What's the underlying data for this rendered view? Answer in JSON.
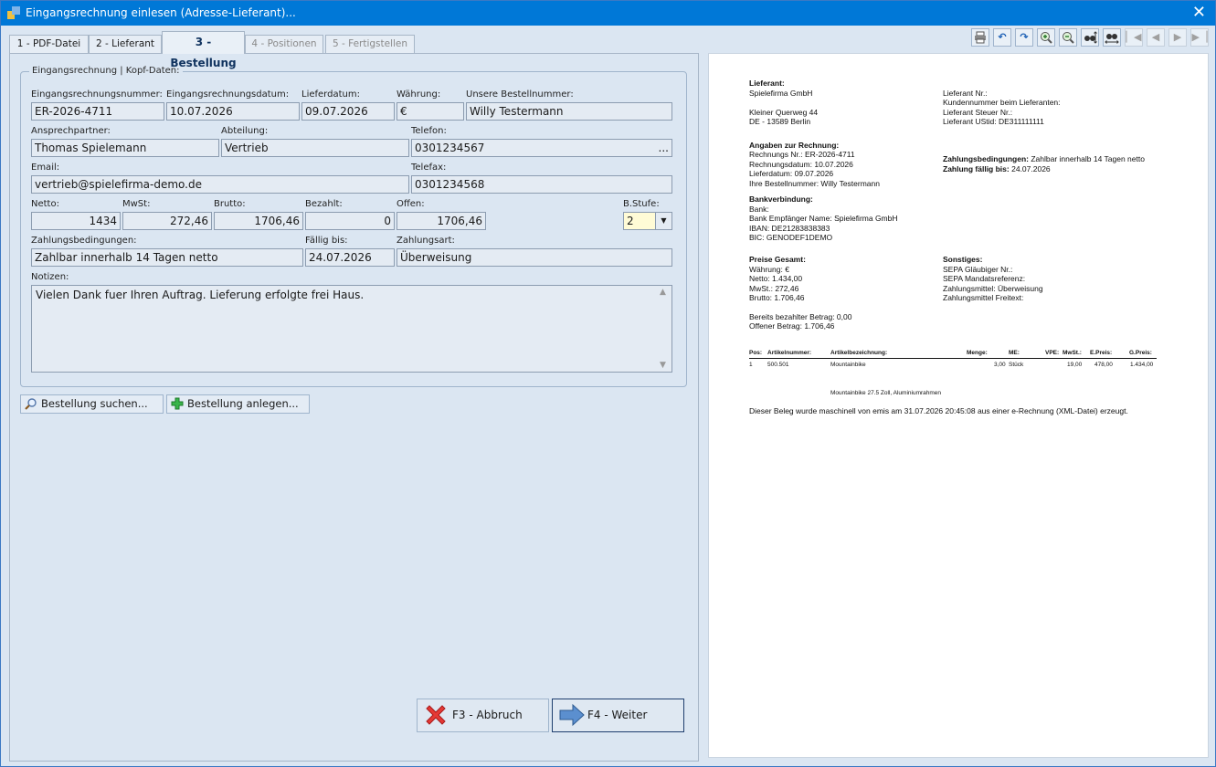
{
  "window": {
    "title": "Eingangsrechnung einlesen (Adresse-Lieferant)..."
  },
  "tabs": [
    {
      "label": "1 - PDF-Datei"
    },
    {
      "label": "2 - Lieferant"
    },
    {
      "label": "3 - Bestellung"
    },
    {
      "label": "4 - Positionen"
    },
    {
      "label": "5 - Fertigstellen"
    }
  ],
  "form": {
    "group_title": "Eingangsrechnung | Kopf-Daten:",
    "labels": {
      "invoice_no": "Eingangsrechnungsnummer:",
      "invoice_date": "Eingangsrechnungsdatum:",
      "delivery_date": "Lieferdatum:",
      "currency": "Währung:",
      "order_no": "Unsere Bestellnummer:",
      "contact": "Ansprechpartner:",
      "department": "Abteilung:",
      "phone": "Telefon:",
      "email": "Email:",
      "fax": "Telefax:",
      "net": "Netto:",
      "vat": "MwSt:",
      "gross": "Brutto:",
      "paid": "Bezahlt:",
      "open": "Offen:",
      "level": "B.Stufe:",
      "terms": "Zahlungsbedingungen:",
      "due": "Fällig bis:",
      "payment_type": "Zahlungsart:",
      "notes": "Notizen:"
    },
    "values": {
      "invoice_no": "ER-2026-4711",
      "invoice_date": "10.07.2026",
      "delivery_date": "09.07.2026",
      "currency": "€",
      "order_no": "Willy Testermann",
      "contact": "Thomas Spielemann",
      "department": "Vertrieb",
      "phone": "0301234567",
      "phone_more": "...",
      "email": "vertrieb@spielefirma-demo.de",
      "fax": "0301234568",
      "net": "1434",
      "vat": "272,46",
      "gross": "1706,46",
      "paid": "0",
      "open": "1706,46",
      "level": "2",
      "terms": "Zahlbar innerhalb 14 Tagen netto",
      "due": "24.07.2026",
      "payment_type": "Überweisung",
      "notes": "Vielen Dank fuer Ihren Auftrag. Lieferung erfolgte frei Haus."
    }
  },
  "buttons": {
    "search_order": "Bestellung suchen...",
    "create_order": "Bestellung anlegen...",
    "cancel": "F3 - Abbruch",
    "next": "F4 - Weiter"
  },
  "toolbar": [
    "print-icon",
    "undo-icon",
    "redo-icon",
    "zoom-in-icon",
    "zoom-out-icon",
    "fit-height-icon",
    "fit-width-icon",
    "first-page-icon",
    "prev-page-icon",
    "next-page-icon",
    "last-page-icon"
  ],
  "preview": {
    "supplier_h": "Lieferant:",
    "supplier_name": "Spielefirma GmbH",
    "street": "Kleiner Querweg 44",
    "city": "DE - 13589 Berlin",
    "supplier_no": "Lieferant Nr.:",
    "customer_no": "Kundennummer beim Lieferanten:",
    "tax_no": "Lieferant Steuer Nr.:",
    "ustid": "Lieferant UStid: DE311111111",
    "invoice_h": "Angaben zur Rechnung:",
    "invoice_no": "Rechnungs Nr.: ER-2026-4711",
    "invoice_date": "Rechnungsdatum: 10.07.2026",
    "delivery_date": "Lieferdatum: 09.07.2026",
    "order_no": "Ihre Bestellnummer: Willy Testermann",
    "terms_h": "Zahlungsbedingungen:",
    "terms_v": "Zahlbar innerhalb 14 Tagen netto",
    "due_h": "Zahlung fällig bis:",
    "due_v": "24.07.2026",
    "bank_h": "Bankverbindung:",
    "bank": "Bank:",
    "bank_recipient": "Bank Empfänger Name: Spielefirma GmbH",
    "iban": "IBAN: DE21283838383",
    "bic": "BIC: GENODEF1DEMO",
    "prices_h": "Preise Gesamt:",
    "currency": "Währung: €",
    "net": "Netto: 1.434,00",
    "vat": "MwSt.: 272,46",
    "gross": "Brutto: 1.706,46",
    "other_h": "Sonstiges:",
    "sepa_creditor": "SEPA Gläubiger Nr.:",
    "sepa_mandate": "SEPA Mandatsreferenz:",
    "payment_means": "Zahlungsmittel: Überweisung",
    "payment_text": "Zahlungsmittel Freitext:",
    "paid": "Bereits bezahlter Betrag: 0,00",
    "open": "Offener Betrag: 1.706,46",
    "table": {
      "headers": [
        "Pos:",
        "Artikelnummer:",
        "Artikelbezeichnung:",
        "Menge:",
        "ME:",
        "VPE:",
        "MwSt.:",
        "E.Preis:",
        "G.Preis:"
      ],
      "row": [
        "1",
        "500.501",
        "Mountainbike",
        "3,00",
        "Stück",
        "",
        "19,00",
        "478,00",
        "1.434,00"
      ],
      "detail": "Mountainbike 27.5 Zoll, Aluminiumrahmen"
    },
    "footer": "Dieser Beleg wurde maschinell von emis am 31.07.2026  20:45:08 aus einer e-Rechnung (XML-Datei) erzeugt."
  }
}
